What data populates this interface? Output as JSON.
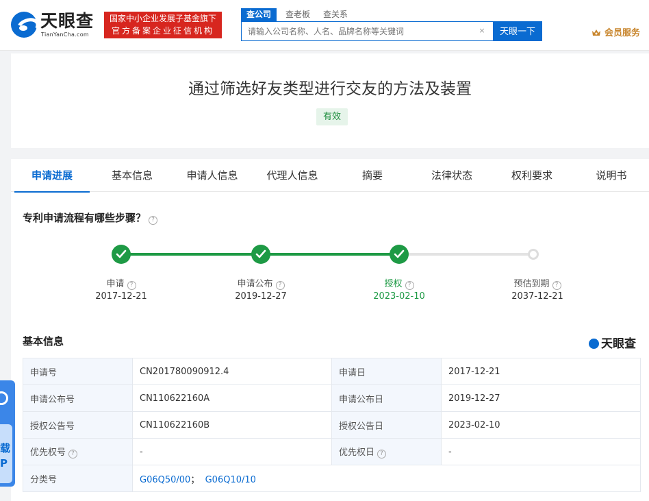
{
  "header": {
    "logo_cn": "天眼查",
    "logo_en": "TianYanCha.com",
    "badge_line1": "国家中小企业发展子基金旗下",
    "badge_line2": "官方备案企业征信机构",
    "search_tabs": [
      "查公司",
      "查老板",
      "查关系"
    ],
    "search_placeholder": "请输入公司名称、人名、品牌名称等关键词",
    "search_clear": "×",
    "search_button": "天眼一下",
    "vip_label": "会员服务"
  },
  "patent": {
    "title": "通过筛选好友类型进行交友的方法及装置",
    "status": "有效"
  },
  "tabs": [
    "申请进展",
    "基本信息",
    "申请人信息",
    "代理人信息",
    "摘要",
    "法律状态",
    "权利要求",
    "说明书"
  ],
  "process": {
    "title": "专利申请流程有哪些步骤？",
    "help": "?",
    "steps": [
      {
        "label": "申请",
        "date": "2017-12-21",
        "done": true
      },
      {
        "label": "申请公布",
        "date": "2019-12-27",
        "done": true
      },
      {
        "label": "授权",
        "date": "2023-02-10",
        "done": true
      },
      {
        "label": "预估到期",
        "date": "2037-12-21",
        "done": false
      }
    ]
  },
  "basic": {
    "title": "基本信息",
    "brand": "天眼查",
    "rows": [
      {
        "k1": "申请号",
        "v1": "CN201780090912.4",
        "k2": "申请日",
        "v2": "2017-12-21"
      },
      {
        "k1": "申请公布号",
        "v1": "CN110622160A",
        "k2": "申请公布日",
        "v2": "2019-12-27"
      },
      {
        "k1": "授权公告号",
        "v1": "CN110622160B",
        "k2": "授权公告日",
        "v2": "2023-02-10"
      },
      {
        "k1": "优先权号",
        "v1": "-",
        "k2": "优先权日",
        "v2": "-"
      }
    ],
    "class_label": "分类号",
    "class_values": [
      "G06Q50/00",
      "G06Q10/10"
    ],
    "class_sep": "；"
  },
  "float_app": {
    "text_line1": "载",
    "text_line2": "P"
  },
  "colors": {
    "brand_blue": "#0a6bd1",
    "done_green": "#1e9a45",
    "badge_red": "#d7261f",
    "vip_gold": "#c8852c"
  }
}
